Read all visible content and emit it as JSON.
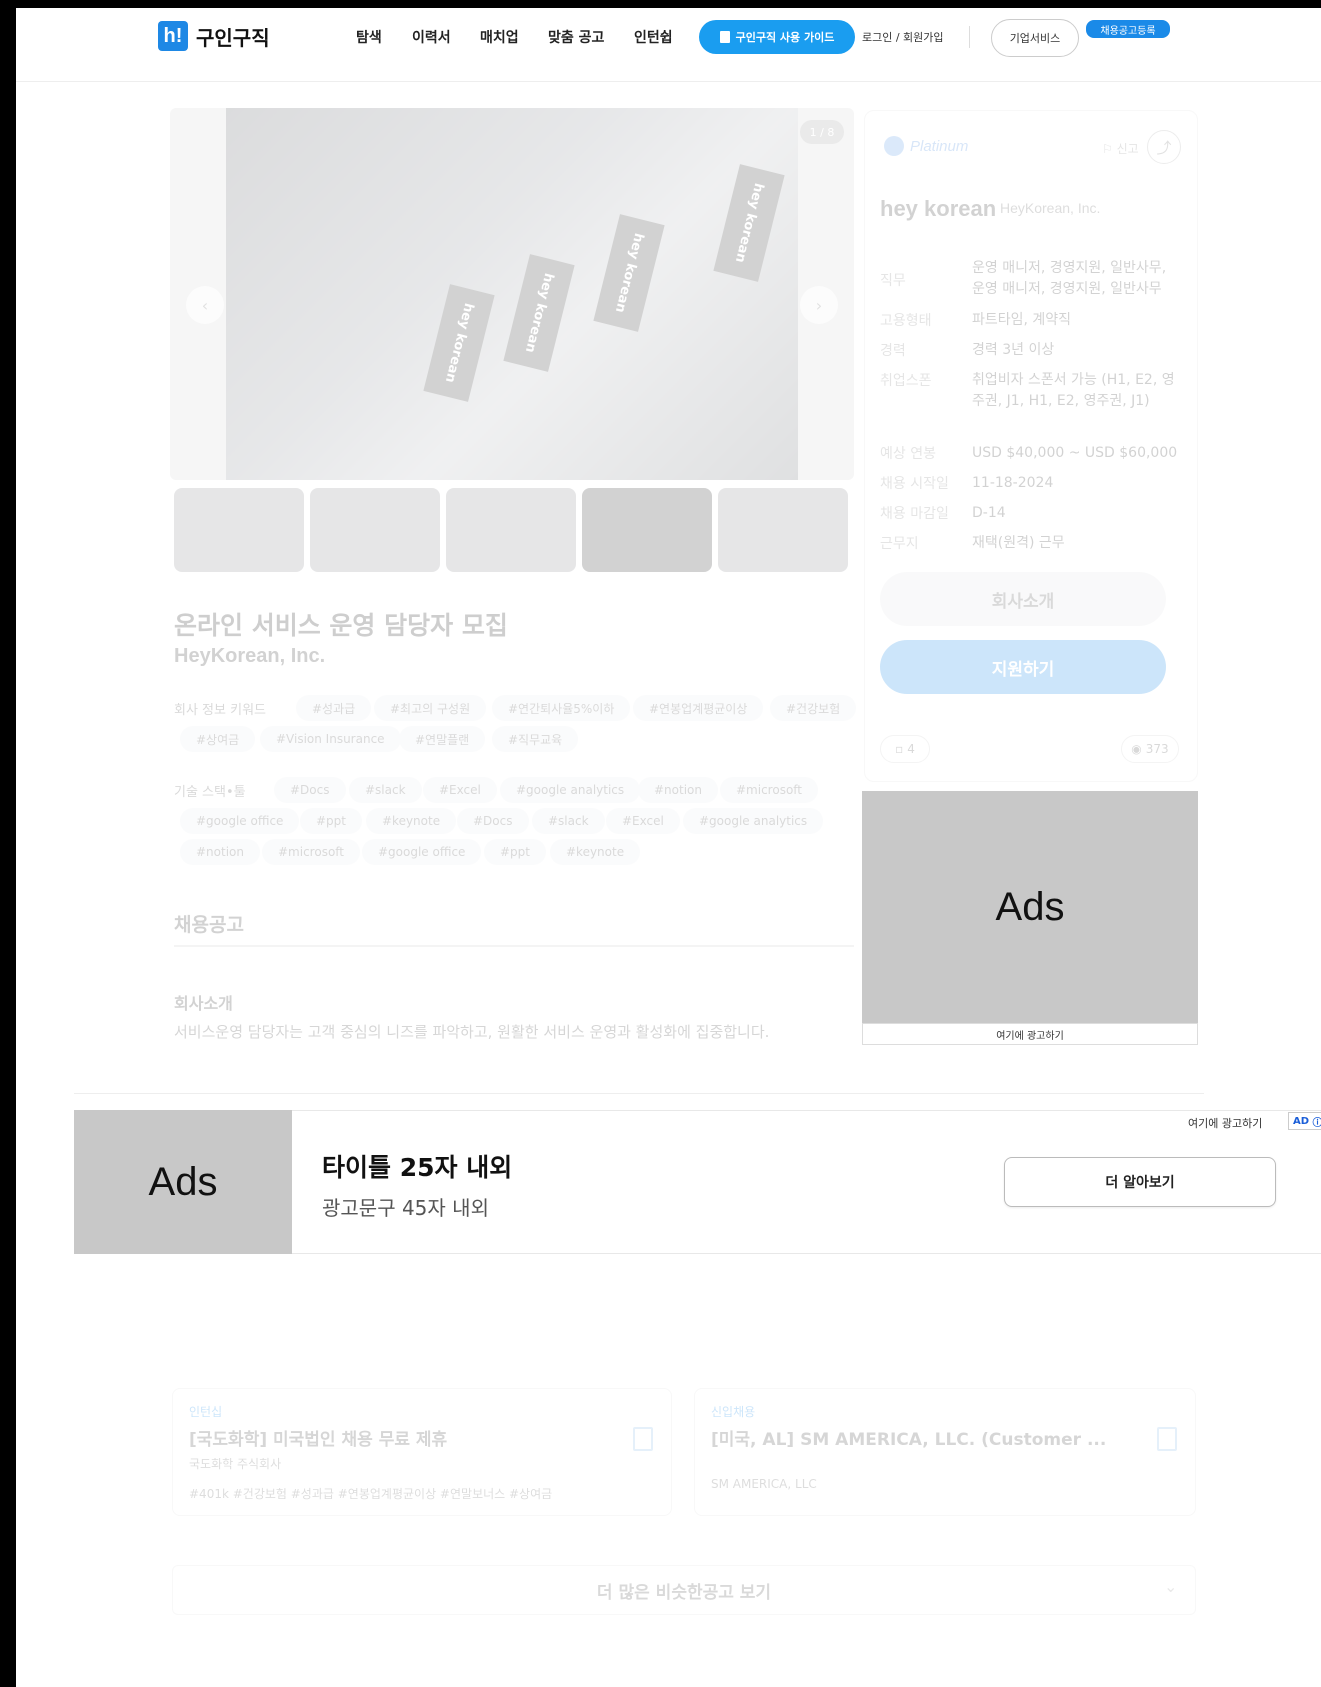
{
  "header": {
    "logo_mark": "h!",
    "logo_text": "구인구직",
    "nav": [
      "탐색",
      "이력서",
      "매치업",
      "맞춤 공고",
      "인턴쉽"
    ],
    "guide_label": "구인구직 사용 가이드",
    "login_label": "로그인 / 회원가입",
    "biz_label": "기업서비스",
    "post_label": "채용공고등록"
  },
  "gallery": {
    "counter": "1 / 8",
    "flag_text": "hey korean",
    "prev_icon": "chevron-left-icon",
    "next_icon": "chevron-right-icon"
  },
  "job": {
    "title": "온라인 서비스 운영 담당자 모집",
    "company": "HeyKorean, Inc.",
    "keyword_label": "회사 정보 키워드",
    "keywords": [
      "#성과급",
      "#최고의 구성원",
      "#연간퇴사율5%이하",
      "#연봉업계평균이상",
      "#건강보험",
      "#상여금",
      "#Vision Insurance",
      "#연말플랜",
      "#직무교육"
    ],
    "skills_label": "기술 스택•툴",
    "skills": [
      "#Docs",
      "#slack",
      "#Excel",
      "#google analytics",
      "#notion",
      "#microsoft",
      "#google office",
      "#ppt",
      "#keynote",
      "#Docs",
      "#slack",
      "#Excel",
      "#google analytics",
      "#notion",
      "#microsoft",
      "#google office",
      "#ppt",
      "#keynote"
    ],
    "section_title": "채용공고",
    "intro_title": "회사소개",
    "intro_text": "서비스운영 담당자는 고객 중심의 니즈를 파악하고, 원활한 서비스 운영과 활성화에 집중합니다."
  },
  "side": {
    "tier": "Platinum",
    "report_label": "신고",
    "brand_logo": "hey korean",
    "brand_name": "HeyKorean, Inc.",
    "info": [
      {
        "k": "직무",
        "v": "운영 매니저, 경영지원, 일반사무, 운영 매니저, 경영지원, 일반사무"
      },
      {
        "k": "고용형태",
        "v": "파트타임, 계약직"
      },
      {
        "k": "경력",
        "v": "경력 3년 이상"
      },
      {
        "k": "취업스폰",
        "v": "취업비자 스폰서 가능 (H1, E2, 영주권, J1, H1, E2, 영주권, J1)"
      },
      {
        "k": "예상 연봉",
        "v": "USD $40,000 ~ USD $60,000"
      },
      {
        "k": "채용 시작일",
        "v": "11-18-2024"
      },
      {
        "k": "채용 마감일",
        "v": "D-14"
      },
      {
        "k": "근무지",
        "v": "재택(원격) 근무"
      }
    ],
    "company_btn": "회사소개",
    "apply_btn": "지원하기",
    "save_count": "4",
    "view_count": "373"
  },
  "ads_right": {
    "label": "Ads",
    "footer": "여기에 광고하기"
  },
  "banner": {
    "ads_label": "Ads",
    "title": "타이틀 25자 내외",
    "subtitle": "광고문구 45자 내외",
    "button": "더 알아보기",
    "ad_here": "여기에 광고하기",
    "ad_badge": "AD"
  },
  "similar": {
    "cards": [
      {
        "tag": "인턴십",
        "title": "[국도화학] 미국법인 채용 무료 제휴",
        "company": "국도화학 주식회사",
        "keywords": "#401k #건강보험 #성과급 #연봉업계평균이상 #연말보너스 #상여금"
      },
      {
        "tag": "신입채용",
        "title": "[미국, AL] SM AMERICA, LLC. (Customer ...",
        "company": "SM AMERICA, LLC"
      }
    ],
    "more_label": "더 많은 비슷한공고 보기"
  }
}
